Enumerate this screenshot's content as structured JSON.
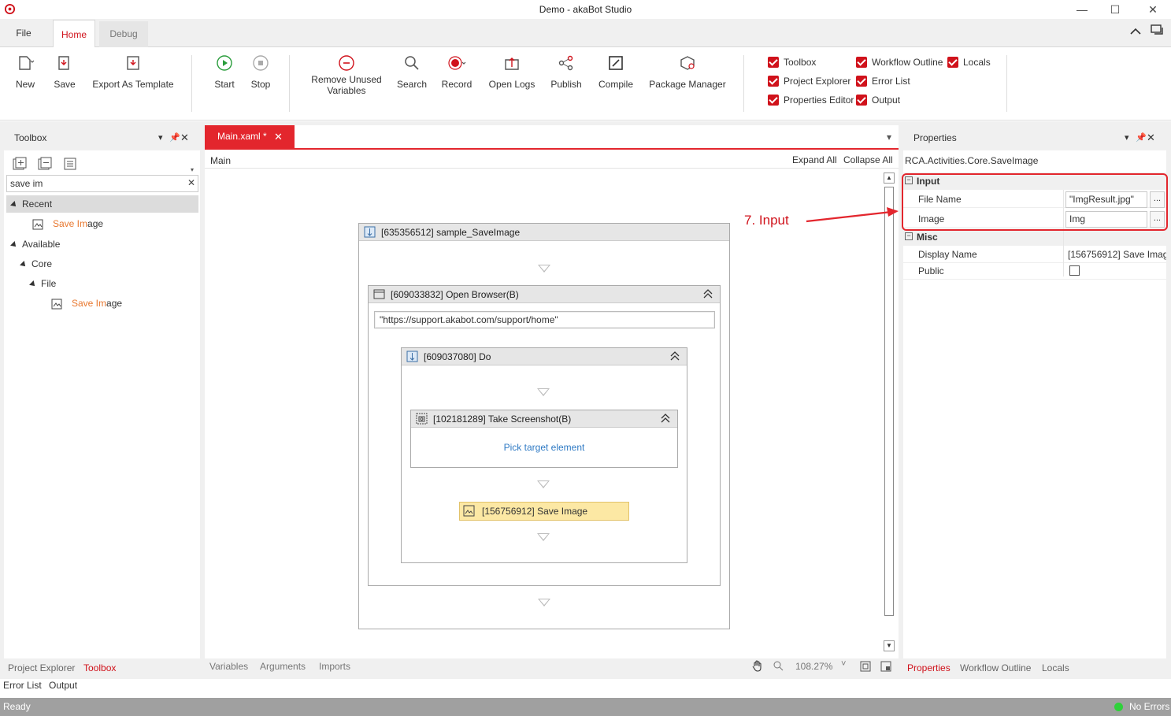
{
  "window": {
    "title": "Demo - akaBot Studio"
  },
  "menu_tabs": {
    "file": "File",
    "home": "Home",
    "debug": "Debug"
  },
  "ribbon": {
    "new": "New",
    "save": "Save",
    "export_template": "Export As Template",
    "start": "Start",
    "stop": "Stop",
    "remove_unused_1": "Remove Unused",
    "remove_unused_2": "Variables",
    "search": "Search",
    "record": "Record",
    "open_logs": "Open Logs",
    "publish": "Publish",
    "compile": "Compile",
    "package_manager": "Package Manager",
    "checkboxes": {
      "toolbox": "Toolbox",
      "project_explorer": "Project Explorer",
      "properties_editor": "Properties Editor",
      "workflow_outline": "Workflow Outline",
      "error_list": "Error List",
      "output": "Output",
      "locals": "Locals"
    }
  },
  "toolbox": {
    "title": "Toolbox",
    "search_value": "save im",
    "recent": "Recent",
    "available": "Available",
    "core": "Core",
    "file": "File",
    "item_match": "Save Im",
    "item_rest": "age"
  },
  "designer": {
    "tab_label": "Main.xaml *",
    "breadcrumb": "Main",
    "expand_all": "Expand All",
    "collapse_all": "Collapse All",
    "seq_title": "[635356512] sample_SaveImage",
    "browser_title": "[609033832] Open Browser(B)",
    "browser_url": "\"https://support.akabot.com/support/home\"",
    "do_title": "[609037080] Do",
    "screenshot_title": "[102181289] Take Screenshot(B)",
    "pick_target": "Pick target element",
    "save_image": "[156756912] Save Image",
    "bottom_variables": "Variables",
    "bottom_arguments": "Arguments",
    "bottom_imports": "Imports",
    "zoom": "108.27%"
  },
  "annotation": {
    "label": "7. Input"
  },
  "properties": {
    "title": "Properties",
    "activity_type": "RCA.Activities.Core.SaveImage",
    "input_group": "Input",
    "file_name_label": "File Name",
    "file_name_value": "\"ImgResult.jpg\"",
    "image_label": "Image",
    "image_value": "Img",
    "misc_group": "Misc",
    "display_name_label": "Display Name",
    "display_name_value": "[156756912] Save Imag",
    "public_label": "Public",
    "ellipsis": "..."
  },
  "bottom_tabs": {
    "project_explorer": "Project Explorer",
    "toolbox": "Toolbox",
    "error_list": "Error List",
    "output": "Output",
    "properties": "Properties",
    "workflow_outline": "Workflow Outline",
    "locals": "Locals"
  },
  "status": {
    "ready": "Ready",
    "errors": "No Errors"
  },
  "colors": {
    "accent": "#d0121b",
    "highlight": "#fce8a4",
    "orange": "#e8772e"
  }
}
